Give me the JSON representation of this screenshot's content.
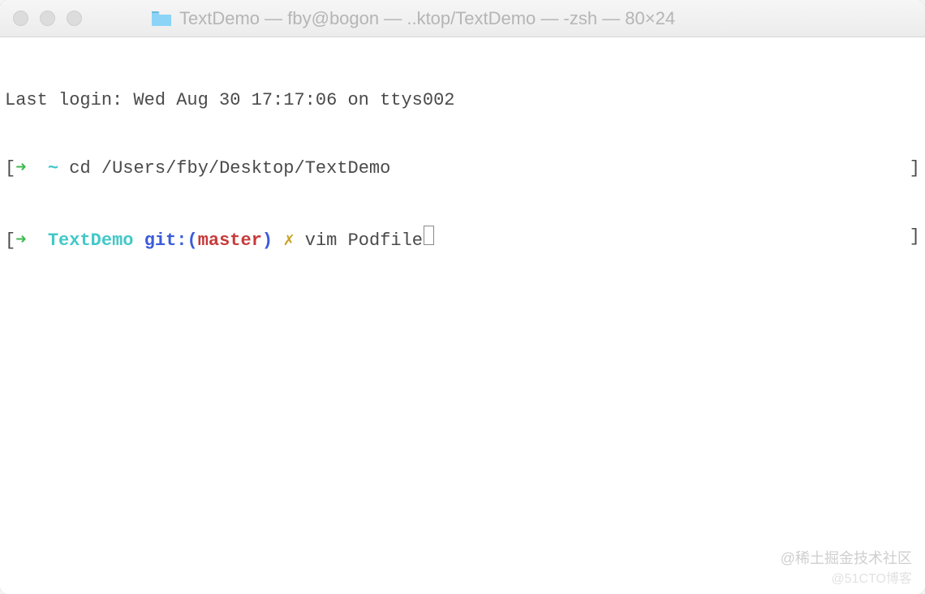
{
  "titlebar": {
    "title": "TextDemo — fby@bogon — ..ktop/TextDemo — -zsh — 80×24"
  },
  "terminal": {
    "last_login": "Last login: Wed Aug 30 17:17:06 on ttys002",
    "line1": {
      "bracket_open": "[",
      "arrow": "➜",
      "tilde": "~",
      "command": "cd /Users/fby/Desktop/TextDemo",
      "bracket_close": "]"
    },
    "line2": {
      "bracket_open": "[",
      "arrow": "➜",
      "dirname": "TextDemo",
      "git_label": "git:",
      "paren_open": "(",
      "branch": "master",
      "paren_close": ")",
      "dirty": "✗",
      "command": "vim Podfile",
      "bracket_close": "]"
    }
  },
  "watermarks": {
    "w1": "@稀土掘金技术社区",
    "w2": "@51CTO博客"
  }
}
